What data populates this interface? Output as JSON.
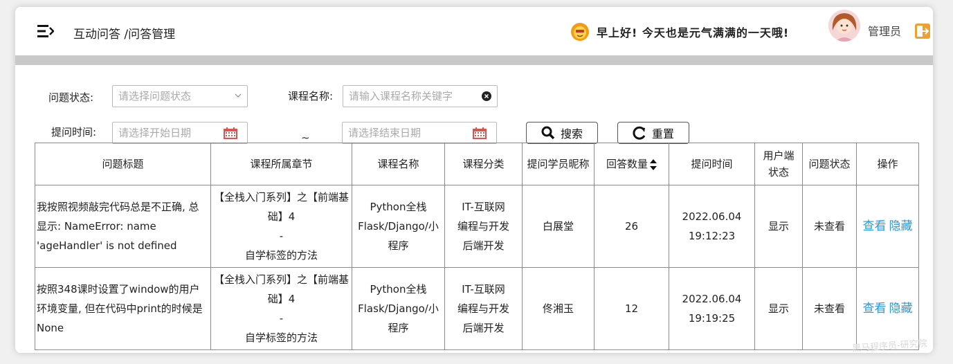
{
  "header": {
    "breadcrumb": "互动问答 /问答管理",
    "greeting": "早上好! 今天也是元气满满的一天哦!",
    "user_name": "管理员"
  },
  "filters": {
    "status_label": "问题状态:",
    "status_placeholder": "请选择问题状态",
    "course_label": "课程名称:",
    "course_placeholder": "请输入课程名称关键字",
    "time_label": "提问时间:",
    "start_placeholder": "请选择开始日期",
    "range_sep": "~",
    "end_placeholder": "请选择结束日期",
    "search_label": "搜索",
    "reset_label": "重置"
  },
  "table": {
    "headers": [
      "问题标题",
      "课程所属章节",
      "课程名称",
      "课程分类",
      "提问学员昵称",
      "回答数量",
      "提问时间",
      "用户端状态",
      "问题状态",
      "操作"
    ],
    "rows": [
      {
        "title": "我按照视频敲完代码总是不正确, 总显示:  NameError: name 'ageHandler' is not defined",
        "chapter": "【全栈入门系列】之【前端基础】4\n-\n自学标签的方法",
        "course": "Python全栈Flask/Django/小程序",
        "category": "IT-互联网\n编程与开发\n后端开发",
        "student": "白展堂",
        "answers": "26",
        "time": "2022.06.04\n19:12:23",
        "client_status": "显示",
        "status": "未查看",
        "view": "查看",
        "hide": "隐藏"
      },
      {
        "title": "按照348课时设置了window的用户环境变量, 但在代码中print的时候是None",
        "chapter": "【全栈入门系列】之【前端基础】4\n-\n自学标签的方法",
        "course": "Python全栈Flask/Django/小程序",
        "category": "IT-互联网\n编程与开发\n后端开发",
        "student": "佟湘玉",
        "answers": "12",
        "time": "2022.06.04\n19:19:25",
        "client_status": "显示",
        "status": "未查看",
        "view": "查看",
        "hide": "隐藏"
      }
    ]
  },
  "watermark": "黑马程序员-研究院",
  "colors": {
    "link": "#2a9ad6",
    "calendar": "#d9534f",
    "logout": "#f0a030"
  }
}
